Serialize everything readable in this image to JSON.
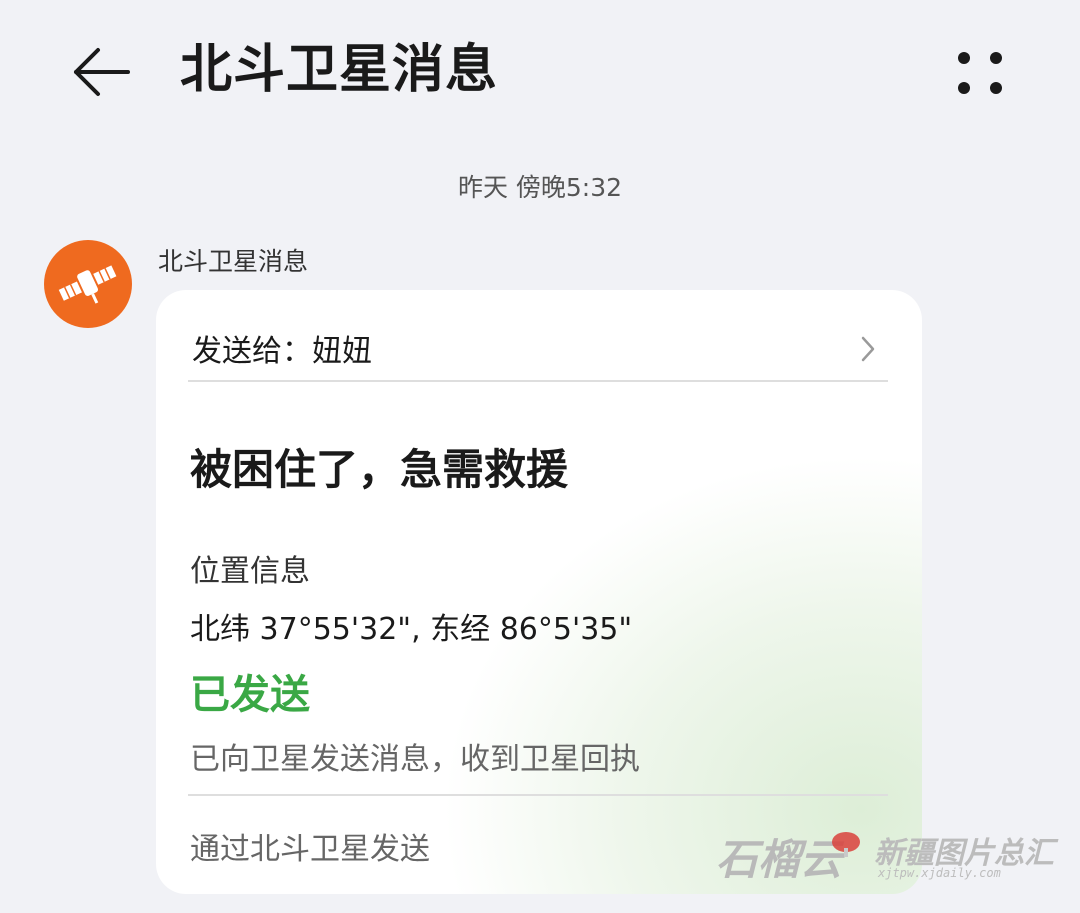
{
  "header": {
    "title": "北斗卫星消息",
    "back_icon": "arrow-left-icon",
    "menu_icon": "more-dots-icon"
  },
  "thread": {
    "timestamp": "昨天 傍晚5:32",
    "sender_name": "北斗卫星消息",
    "avatar_icon": "satellite-icon",
    "avatar_color": "#ef6a1f"
  },
  "card": {
    "recipient": "发送给：妞妞",
    "message": "被困住了，急需救援",
    "location_label": "位置信息",
    "coordinates": "北纬 37°55'32\", 东经 86°5'35\"",
    "status": "已发送",
    "status_color": "#3aa845",
    "status_detail": "已向卫星发送消息，收到卫星回执",
    "footer": "通过北斗卫星发送"
  },
  "watermark": {
    "script": "石榴云",
    "name": "新疆图片总汇",
    "url": "xjtpw.xjdaily.com"
  }
}
